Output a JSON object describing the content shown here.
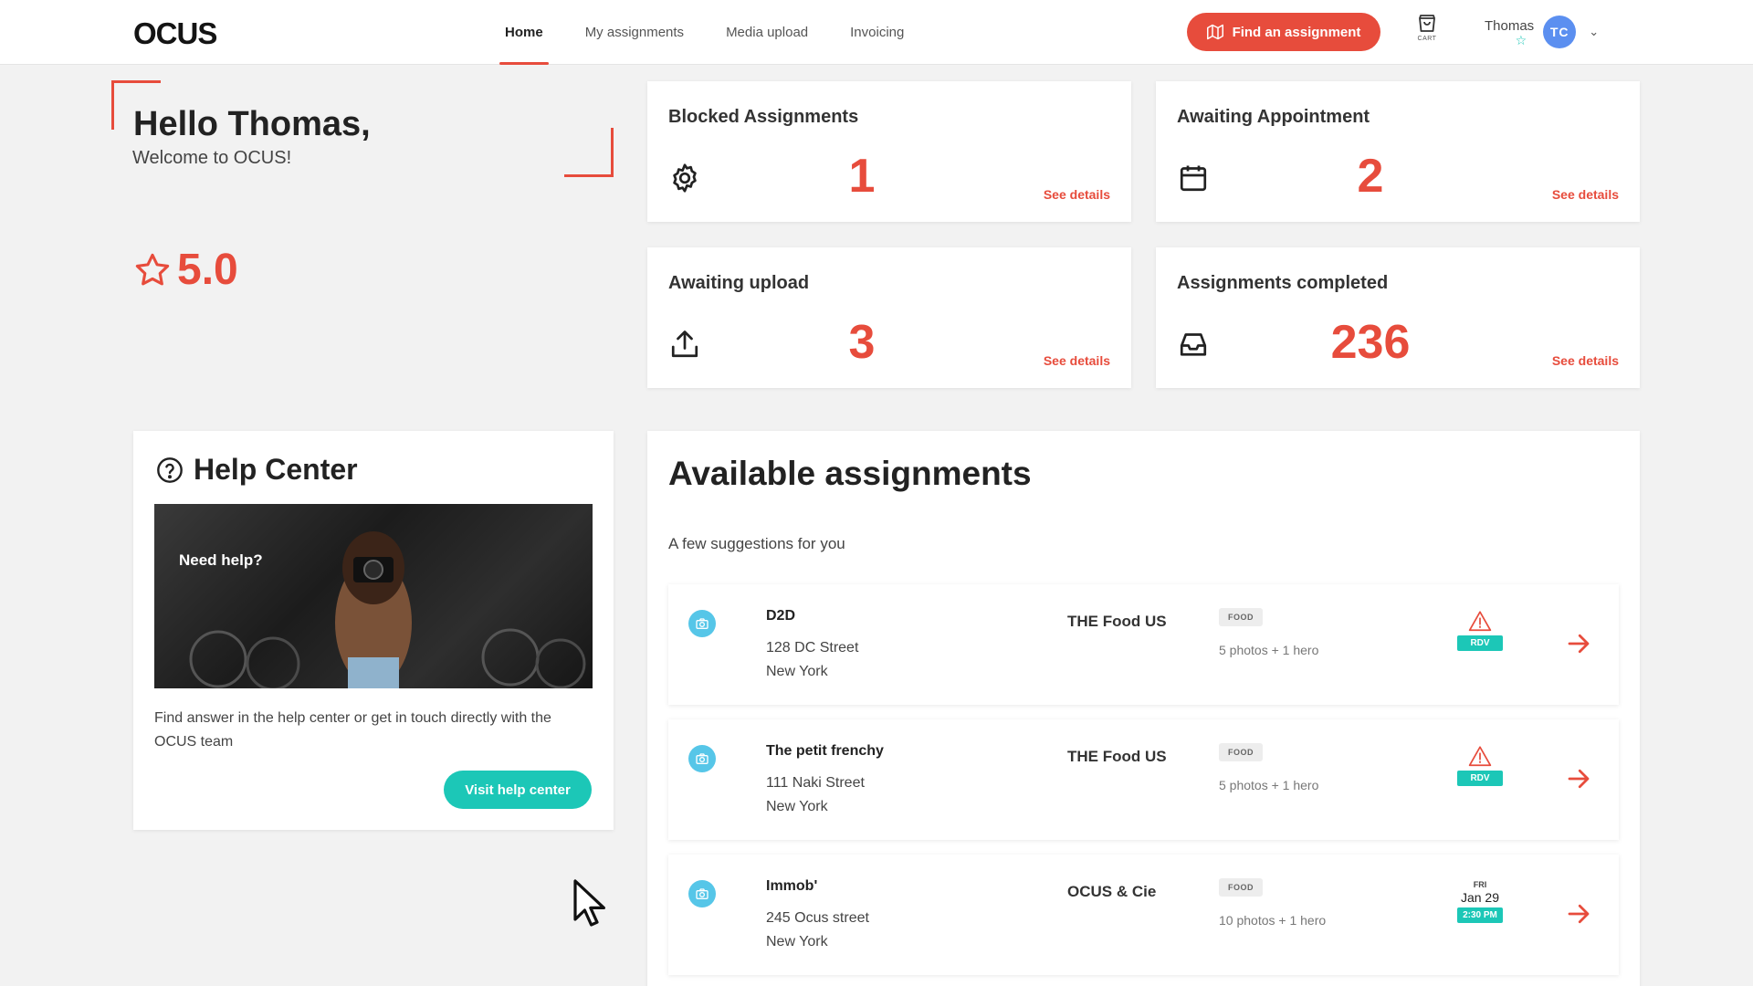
{
  "header": {
    "logo": "OCUS",
    "nav": [
      {
        "label": "Home",
        "active": true
      },
      {
        "label": "My assignments",
        "active": false
      },
      {
        "label": "Media upload",
        "active": false
      },
      {
        "label": "Invoicing",
        "active": false
      }
    ],
    "find_button": "Find an assignment",
    "cart_label": "CART",
    "user_name": "Thomas",
    "avatar_initials": "TC"
  },
  "welcome": {
    "hello": "Hello Thomas,",
    "subtitle": "Welcome to OCUS!",
    "rating": "5.0"
  },
  "stats": [
    {
      "title": "Blocked Assignments",
      "value": "1",
      "link": "See details",
      "icon": "gear-icon"
    },
    {
      "title": "Awaiting Appointment",
      "value": "2",
      "link": "See details",
      "icon": "calendar-icon"
    },
    {
      "title": "Awaiting upload",
      "value": "3",
      "link": "See details",
      "icon": "upload-icon"
    },
    {
      "title": "Assignments completed",
      "value": "236",
      "link": "See details",
      "icon": "inbox-icon"
    }
  ],
  "help": {
    "title": "Help Center",
    "image_text": "Need help?",
    "description": "Find answer in the help center or get in touch directly with the OCUS team",
    "button": "Visit help center"
  },
  "available": {
    "title": "Available assignments",
    "subtitle": "A few suggestions for you",
    "rows": [
      {
        "name": "D2D",
        "street": "128 DC Street",
        "city": "New York",
        "client": "THE Food US",
        "tag": "FOOD",
        "photos": "5 photos + 1 hero",
        "status": "RDV"
      },
      {
        "name": "The petit frenchy",
        "street": "111 Naki Street",
        "city": "New York",
        "client": "THE Food US",
        "tag": "FOOD",
        "photos": "5 photos + 1 hero",
        "status": "RDV"
      },
      {
        "name": "Immob'",
        "street": "245 Ocus street",
        "city": "New York",
        "client": "OCUS & Cie",
        "tag": "FOOD",
        "photos": "10 photos + 1 hero",
        "day": "FRI",
        "date": "Jan 29",
        "time": "2:30 PM"
      }
    ]
  },
  "colors": {
    "accent": "#e74c3c",
    "teal": "#1cc7b7",
    "camera": "#56c6e8",
    "avatar": "#5b8ff0"
  }
}
